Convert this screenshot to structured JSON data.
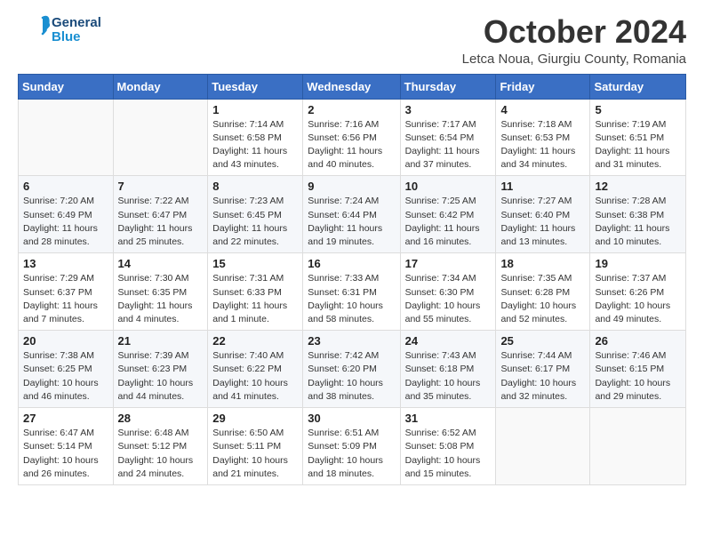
{
  "header": {
    "logo": {
      "line1": "General",
      "line2": "Blue"
    },
    "title": "October 2024",
    "location": "Letca Noua, Giurgiu County, Romania"
  },
  "days_of_week": [
    "Sunday",
    "Monday",
    "Tuesday",
    "Wednesday",
    "Thursday",
    "Friday",
    "Saturday"
  ],
  "weeks": [
    [
      {
        "day": "",
        "info": ""
      },
      {
        "day": "",
        "info": ""
      },
      {
        "day": "1",
        "info": "Sunrise: 7:14 AM\nSunset: 6:58 PM\nDaylight: 11 hours and 43 minutes."
      },
      {
        "day": "2",
        "info": "Sunrise: 7:16 AM\nSunset: 6:56 PM\nDaylight: 11 hours and 40 minutes."
      },
      {
        "day": "3",
        "info": "Sunrise: 7:17 AM\nSunset: 6:54 PM\nDaylight: 11 hours and 37 minutes."
      },
      {
        "day": "4",
        "info": "Sunrise: 7:18 AM\nSunset: 6:53 PM\nDaylight: 11 hours and 34 minutes."
      },
      {
        "day": "5",
        "info": "Sunrise: 7:19 AM\nSunset: 6:51 PM\nDaylight: 11 hours and 31 minutes."
      }
    ],
    [
      {
        "day": "6",
        "info": "Sunrise: 7:20 AM\nSunset: 6:49 PM\nDaylight: 11 hours and 28 minutes."
      },
      {
        "day": "7",
        "info": "Sunrise: 7:22 AM\nSunset: 6:47 PM\nDaylight: 11 hours and 25 minutes."
      },
      {
        "day": "8",
        "info": "Sunrise: 7:23 AM\nSunset: 6:45 PM\nDaylight: 11 hours and 22 minutes."
      },
      {
        "day": "9",
        "info": "Sunrise: 7:24 AM\nSunset: 6:44 PM\nDaylight: 11 hours and 19 minutes."
      },
      {
        "day": "10",
        "info": "Sunrise: 7:25 AM\nSunset: 6:42 PM\nDaylight: 11 hours and 16 minutes."
      },
      {
        "day": "11",
        "info": "Sunrise: 7:27 AM\nSunset: 6:40 PM\nDaylight: 11 hours and 13 minutes."
      },
      {
        "day": "12",
        "info": "Sunrise: 7:28 AM\nSunset: 6:38 PM\nDaylight: 11 hours and 10 minutes."
      }
    ],
    [
      {
        "day": "13",
        "info": "Sunrise: 7:29 AM\nSunset: 6:37 PM\nDaylight: 11 hours and 7 minutes."
      },
      {
        "day": "14",
        "info": "Sunrise: 7:30 AM\nSunset: 6:35 PM\nDaylight: 11 hours and 4 minutes."
      },
      {
        "day": "15",
        "info": "Sunrise: 7:31 AM\nSunset: 6:33 PM\nDaylight: 11 hours and 1 minute."
      },
      {
        "day": "16",
        "info": "Sunrise: 7:33 AM\nSunset: 6:31 PM\nDaylight: 10 hours and 58 minutes."
      },
      {
        "day": "17",
        "info": "Sunrise: 7:34 AM\nSunset: 6:30 PM\nDaylight: 10 hours and 55 minutes."
      },
      {
        "day": "18",
        "info": "Sunrise: 7:35 AM\nSunset: 6:28 PM\nDaylight: 10 hours and 52 minutes."
      },
      {
        "day": "19",
        "info": "Sunrise: 7:37 AM\nSunset: 6:26 PM\nDaylight: 10 hours and 49 minutes."
      }
    ],
    [
      {
        "day": "20",
        "info": "Sunrise: 7:38 AM\nSunset: 6:25 PM\nDaylight: 10 hours and 46 minutes."
      },
      {
        "day": "21",
        "info": "Sunrise: 7:39 AM\nSunset: 6:23 PM\nDaylight: 10 hours and 44 minutes."
      },
      {
        "day": "22",
        "info": "Sunrise: 7:40 AM\nSunset: 6:22 PM\nDaylight: 10 hours and 41 minutes."
      },
      {
        "day": "23",
        "info": "Sunrise: 7:42 AM\nSunset: 6:20 PM\nDaylight: 10 hours and 38 minutes."
      },
      {
        "day": "24",
        "info": "Sunrise: 7:43 AM\nSunset: 6:18 PM\nDaylight: 10 hours and 35 minutes."
      },
      {
        "day": "25",
        "info": "Sunrise: 7:44 AM\nSunset: 6:17 PM\nDaylight: 10 hours and 32 minutes."
      },
      {
        "day": "26",
        "info": "Sunrise: 7:46 AM\nSunset: 6:15 PM\nDaylight: 10 hours and 29 minutes."
      }
    ],
    [
      {
        "day": "27",
        "info": "Sunrise: 6:47 AM\nSunset: 5:14 PM\nDaylight: 10 hours and 26 minutes."
      },
      {
        "day": "28",
        "info": "Sunrise: 6:48 AM\nSunset: 5:12 PM\nDaylight: 10 hours and 24 minutes."
      },
      {
        "day": "29",
        "info": "Sunrise: 6:50 AM\nSunset: 5:11 PM\nDaylight: 10 hours and 21 minutes."
      },
      {
        "day": "30",
        "info": "Sunrise: 6:51 AM\nSunset: 5:09 PM\nDaylight: 10 hours and 18 minutes."
      },
      {
        "day": "31",
        "info": "Sunrise: 6:52 AM\nSunset: 5:08 PM\nDaylight: 10 hours and 15 minutes."
      },
      {
        "day": "",
        "info": ""
      },
      {
        "day": "",
        "info": ""
      }
    ]
  ]
}
